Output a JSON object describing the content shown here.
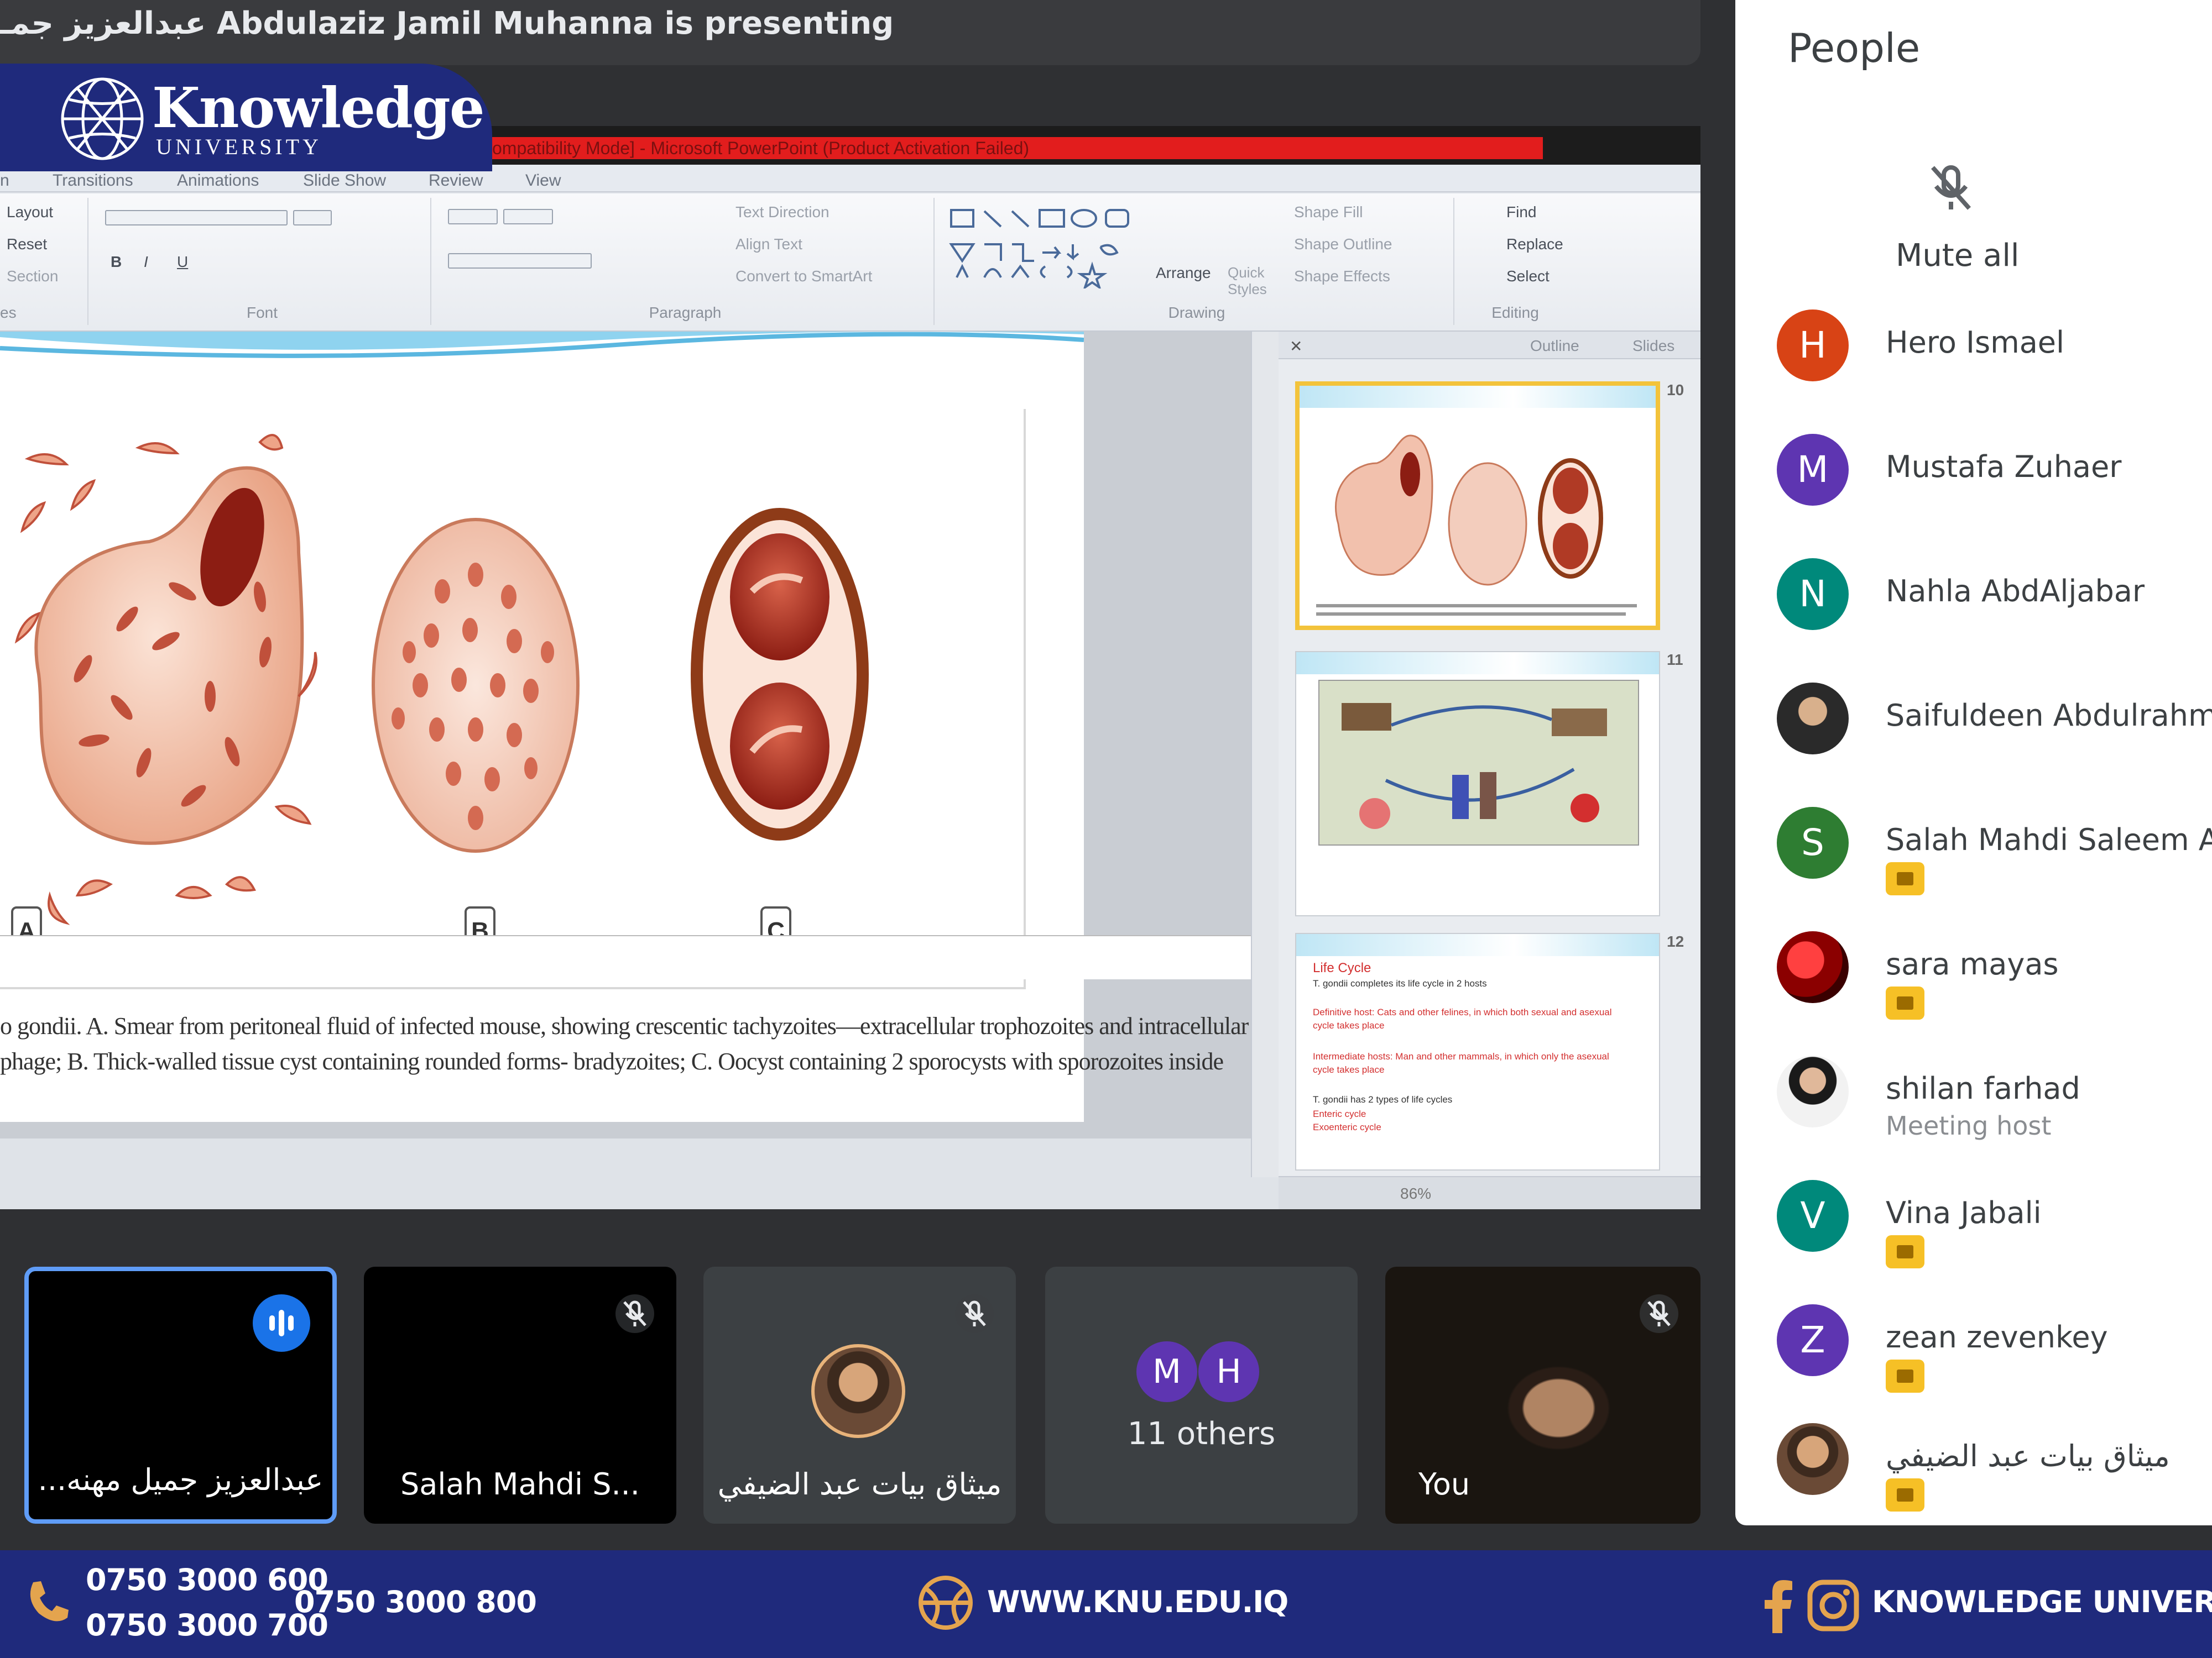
{
  "presenter_bar": {
    "text": "عبدالعزيز جمـ Abdulaziz Jamil Muhanna is presenting"
  },
  "logo": {
    "name": "Knowledge",
    "sub": "UNIVERSITY"
  },
  "ppt": {
    "window_title": "ompatibility Mode] - Microsoft PowerPoint (Product Activation Failed)",
    "menu_tabs": [
      "n",
      "Transitions",
      "Animations",
      "Slide Show",
      "Review",
      "View"
    ],
    "ribbon": {
      "slides_items": [
        "Layout",
        "Reset",
        "Section"
      ],
      "font_label": "Font",
      "paragraph_label": "Paragraph",
      "paragraph_items": [
        "Text Direction",
        "Align Text",
        "Convert to SmartArt"
      ],
      "drawing_label": "Drawing",
      "drawing_items": [
        "Arrange",
        "Quick Styles",
        "Shape Fill",
        "Shape Outline",
        "Shape Effects"
      ],
      "editing_label": "Editing",
      "editing_items": [
        "Find",
        "Replace",
        "Select"
      ],
      "slides_label": "es"
    },
    "slide": {
      "labels": [
        "A",
        "B",
        "C"
      ],
      "caption_line1": "o gondii. A. Smear from peritoneal fluid of infected mouse, showing crescentic tachyzoites—extracellular trophozoites and intracellular",
      "caption_line2": "phage; B. Thick-walled tissue cyst containing rounded forms- bradyzoites; C. Oocyst containing 2 sporocysts with sporozoites inside"
    },
    "thumb_tabs": [
      "Outline",
      "Slides"
    ],
    "thumb_numbers": [
      "10",
      "11",
      "12"
    ],
    "thumb12": {
      "title": "Life Cycle",
      "lines": [
        "T. gondii completes its life cycle in 2 hosts",
        "Definitive host: Cats and other felines, in which both sexual and asexual cycle takes place",
        "Intermediate hosts: Man and other mammals, in which only the asexual cycle takes place",
        "T. gondii has 2 types of life cycles",
        "Enteric cycle",
        "Exoenteric cycle"
      ]
    },
    "zoom": "86%"
  },
  "tiles": [
    {
      "name": "...عبدالعزيز جميل مهنه"
    },
    {
      "name": "Salah Mahdi S..."
    },
    {
      "name": "ميثاق بيات عبد الضيفي"
    },
    {
      "name": "11 others",
      "avatars": [
        "M",
        "H"
      ]
    },
    {
      "name": "You"
    }
  ],
  "people": {
    "title": "People",
    "mute_all": "Mute all",
    "list": [
      {
        "name": "Hero Ismael",
        "initial": "H",
        "color": "#d84315"
      },
      {
        "name": "Mustafa Zuhaer",
        "initial": "M",
        "color": "#5e35b1"
      },
      {
        "name": "Nahla AbdAljabar",
        "initial": "N",
        "color": "#00897b"
      },
      {
        "name": "Saifuldeen Abdulrahma",
        "initial": "",
        "color": "#37474f"
      },
      {
        "name": "Salah Mahdi Saleem Al-",
        "initial": "S",
        "color": "#2e7d32"
      },
      {
        "name": "sara mayas",
        "initial": "",
        "color": "#b71c1c"
      },
      {
        "name": "shilan farhad",
        "initial": "",
        "color": "#cfd8dc",
        "role": "Meeting host"
      },
      {
        "name": "Vina Jabali",
        "initial": "V",
        "color": "#00897b"
      },
      {
        "name": "zean zevenkey",
        "initial": "Z",
        "color": "#5e35b1"
      },
      {
        "name": "ميثاق بيات عبد الضيفي",
        "initial": "",
        "color": "#6d4c41"
      }
    ]
  },
  "footer": {
    "phone1": "0750 3000 600",
    "phone2": "0750 3000 700",
    "phone3": "0750 3000 800",
    "website": "WWW.KNU.EDU.IQ",
    "social": "KNOWLEDGE UNIVERSITY"
  }
}
